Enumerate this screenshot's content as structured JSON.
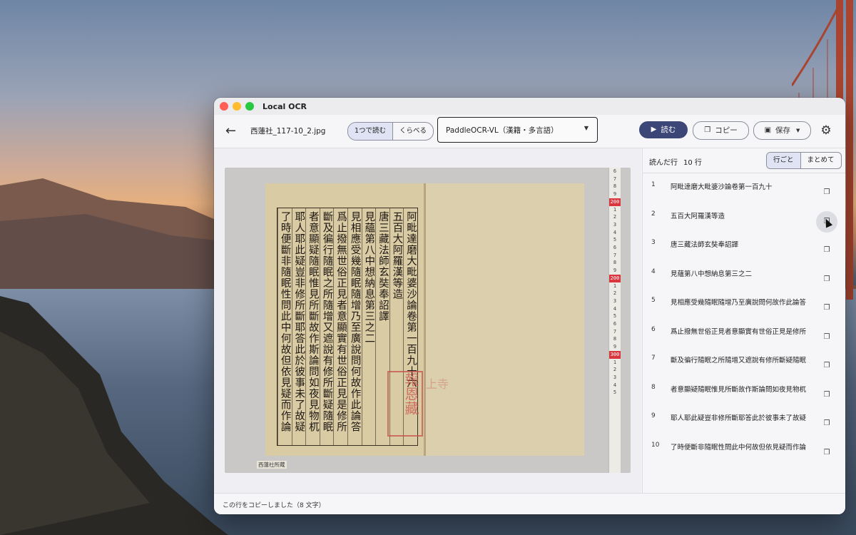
{
  "window": {
    "title": "Local OCR"
  },
  "toolbar": {
    "filename": "西蓮社_117-10_2.jpg",
    "mode": {
      "single": "1つで読む",
      "compare": "くらべる"
    },
    "model": "PaddleOCR-VL（漢籍・多言語）",
    "read_label": "読む",
    "copy_label": "コピー",
    "save_label": "保存"
  },
  "image": {
    "caption": "西蓮社所蔵",
    "columns": [
      "阿毗達磨大毗婆沙論卷第一百九十六",
      "五百大阿羅漢等造",
      "唐三藏法師玄奘奉詔譯",
      "見蘊第八中想納息第三之二",
      "見相應受幾隨眠隨增乃至廣說問何故作此論答",
      "爲止撥無世俗正見者意顯實有世俗正見是修所",
      "斷及徧行隨眠之所隨增又遮說有修所斷疑隨眠",
      "者意顯疑隨眠惟見所斷故作斯論問如夜見物杌",
      "耶人耶此疑豈非修所斷耶答此於彼事未了故疑",
      "了時便斷非隨眠性問此中何故但依見疑而作論"
    ],
    "seal_text": "報恩藏",
    "seal2_text": "上寺",
    "ruler_marks": [
      "6",
      "7",
      "8",
      "9",
      "200",
      "1",
      "2",
      "3",
      "4",
      "5",
      "6",
      "7",
      "8",
      "9",
      "200",
      "1",
      "2",
      "3",
      "4",
      "5",
      "6",
      "7",
      "8",
      "9",
      "300",
      "1",
      "2",
      "3",
      "4",
      "5"
    ]
  },
  "side": {
    "heading": "読んだ行",
    "count": "10 行",
    "view": {
      "per_line": "行ごと",
      "combined": "まとめて"
    },
    "lines": [
      {
        "n": "1",
        "text": "阿毗達磨大毗婆沙論卷第一百九十"
      },
      {
        "n": "2",
        "text": "五百大阿羅漢等造"
      },
      {
        "n": "3",
        "text": "唐三藏法師玄奘奉詔譯"
      },
      {
        "n": "4",
        "text": "見蘊第八中想納息第三之二"
      },
      {
        "n": "5",
        "text": "見相應受幾隨眠隨增乃至廣說問何故作此論答"
      },
      {
        "n": "6",
        "text": "爲止撥無世俗正見者意顯實有世俗正見是修所"
      },
      {
        "n": "7",
        "text": "斷及徧行隨眠之所隨增又遮說有修所斷疑隨眠"
      },
      {
        "n": "8",
        "text": "者意顯疑隨眠惟見所斷故作斯論問如夜見物杌"
      },
      {
        "n": "9",
        "text": "耶人耶此疑豈非修所斷耶答此於彼事未了故疑"
      },
      {
        "n": "10",
        "text": "了時便斷非隨眠性問此中何故但依見疑而作論"
      }
    ]
  },
  "status": {
    "message": "この行をコピーしました（8 文字）"
  },
  "colors": {
    "accent": "#3c4677",
    "seal": "#c8514b"
  }
}
